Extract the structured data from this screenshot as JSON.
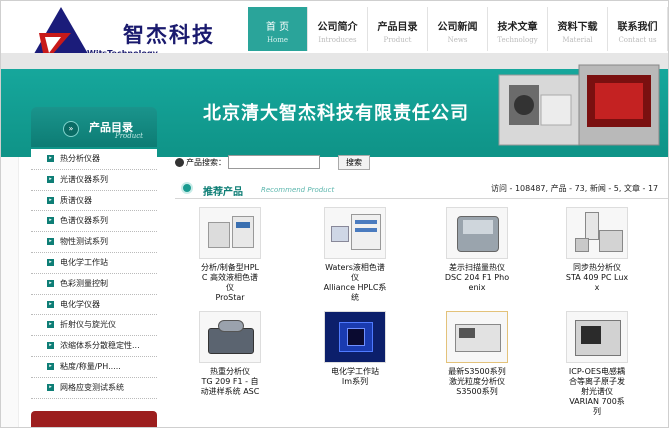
{
  "brand": {
    "name_zh": "智杰科技",
    "name_en": "WitsTechnology"
  },
  "nav": [
    {
      "zh": "首 页",
      "en": "Home"
    },
    {
      "zh": "公司简介",
      "en": "Introduces"
    },
    {
      "zh": "产品目录",
      "en": "Product"
    },
    {
      "zh": "公司新闻",
      "en": "News"
    },
    {
      "zh": "技术文章",
      "en": "Technology"
    },
    {
      "zh": "资料下载",
      "en": "Material"
    },
    {
      "zh": "联系我们",
      "en": "Contact us"
    }
  ],
  "banner": {
    "title": "北京清大智杰科技有限责任公司"
  },
  "sidebar": {
    "title": "产品目录",
    "subtitle": "Product",
    "items": [
      "热分析仪器",
      "光谱仪器系列",
      "质谱仪器",
      "色谱仪器系列",
      "物性测试系列",
      "电化学工作站",
      "色彩测量控制",
      "电化学仪器",
      "折射仪与旋光仪",
      "浓缩体系分散稳定性...",
      "粘度/称量/PH.....",
      "网格应变测试系统"
    ]
  },
  "search": {
    "label": "产品搜索：",
    "value": "",
    "button": "搜索"
  },
  "recommend": {
    "title": "推荐产品",
    "subtitle": "Recommend Product"
  },
  "stats": "访问 - 108487, 产品 - 73, 新闻 - 5, 文章 - 17",
  "products": [
    {
      "name": "分析/制备型HPL\nC 高效液相色谱\n仪\nProStar"
    },
    {
      "name": "Waters液相色谱\n仪\nAlliance HPLC系\n统"
    },
    {
      "name": "差示扫描量热仪\nDSC 204 F1 Pho\nenix"
    },
    {
      "name": "同步热分析仪\nSTA 409 PC Lux\nx"
    },
    {
      "name": "热重分析仪\nTG 209 F1 - 自\n动进样系统 ASC"
    },
    {
      "name": "电化学工作站\nIm系列"
    },
    {
      "name": "最新S3500系列\n激光粒度分析仪\nS3500系列"
    },
    {
      "name": "ICP-OES电感耦\n合等离子原子发\n射光谱仪\nVARIAN 700系\n列"
    }
  ]
}
